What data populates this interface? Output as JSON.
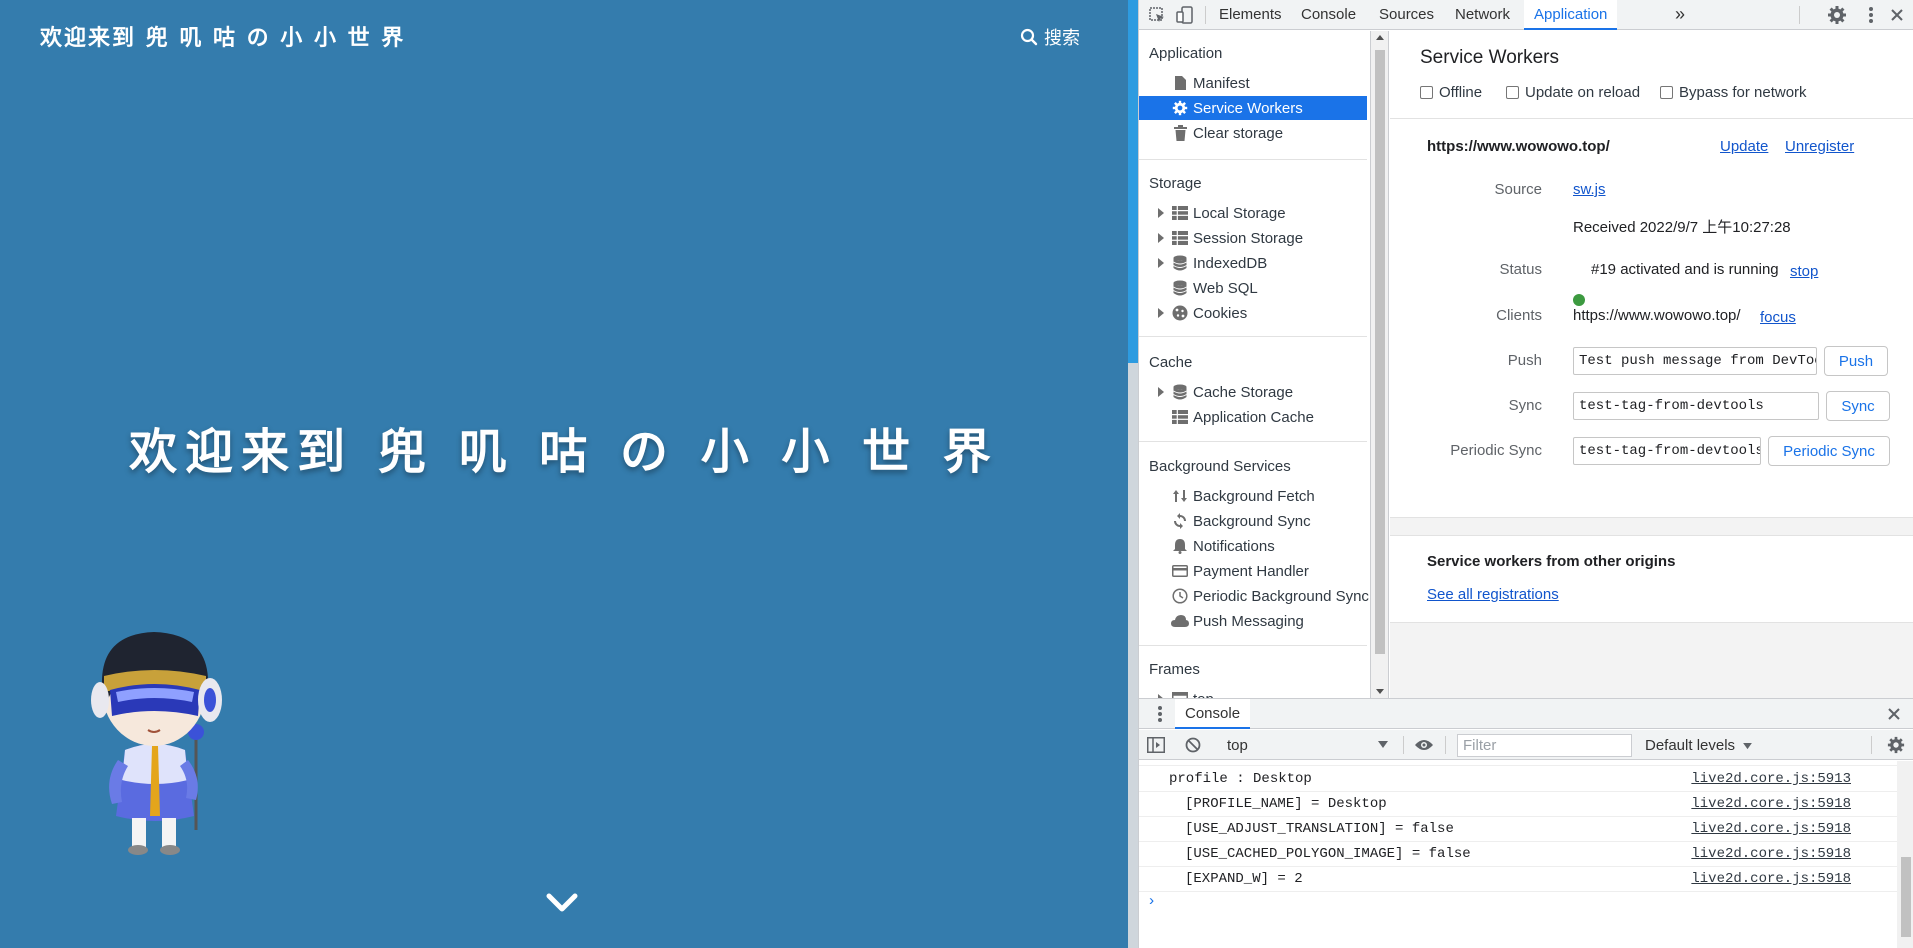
{
  "site": {
    "brand": "欢迎来到 兜 叽 咕 の 小 小 世 界",
    "search_label": "搜索",
    "hero_title": "欢迎来到 兜 叽 咕 の 小 小 世 界",
    "background_color": "#347cad"
  },
  "devtools": {
    "tabs": [
      "Elements",
      "Console",
      "Sources",
      "Network",
      "Application"
    ],
    "active_tab": "Application",
    "more_tabs_glyph": "»",
    "sidebar": {
      "application_header": "Application",
      "application_items": [
        "Manifest",
        "Service Workers",
        "Clear storage"
      ],
      "selected_item": "Service Workers",
      "storage_header": "Storage",
      "storage_items": [
        "Local Storage",
        "Session Storage",
        "IndexedDB",
        "Web SQL",
        "Cookies"
      ],
      "cache_header": "Cache",
      "cache_items": [
        "Cache Storage",
        "Application Cache"
      ],
      "background_header": "Background Services",
      "background_items": [
        "Background Fetch",
        "Background Sync",
        "Notifications",
        "Payment Handler",
        "Periodic Background Sync",
        "Push Messaging"
      ],
      "frames_header": "Frames",
      "frames_items": [
        "top"
      ]
    },
    "service_workers": {
      "title": "Service Workers",
      "checkboxes": [
        "Offline",
        "Update on reload",
        "Bypass for network"
      ],
      "origin": "https://www.wowowo.top/",
      "update_link": "Update",
      "unregister_link": "Unregister",
      "source_label": "Source",
      "source_file": "sw.js",
      "received": "Received 2022/9/7 上午10:27:28",
      "status_label": "Status",
      "status_text": "#19 activated and is running",
      "status_color": "#3c9a40",
      "stop_link": "stop",
      "clients_label": "Clients",
      "clients_value": "https://www.wowowo.top/",
      "focus_link": "focus",
      "push_label": "Push",
      "push_value": "Test push message from DevTools.",
      "push_button": "Push",
      "sync_label": "Sync",
      "sync_value": "test-tag-from-devtools",
      "sync_button": "Sync",
      "periodic_label": "Periodic Sync",
      "periodic_value": "test-tag-from-devtools",
      "periodic_button": "Periodic Sync",
      "other_origins_title": "Service workers from other origins",
      "see_all_link": "See all registrations"
    },
    "console": {
      "tab_label": "Console",
      "context": "top",
      "filter_placeholder": "Filter",
      "levels": "Default levels",
      "lines": [
        {
          "text": "profile : Desktop",
          "indent": 0,
          "source": "live2d.core.js:5913"
        },
        {
          "text": "[PROFILE_NAME] = Desktop",
          "indent": 1,
          "source": "live2d.core.js:5918"
        },
        {
          "text": "[USE_ADJUST_TRANSLATION] = false",
          "indent": 1,
          "source": "live2d.core.js:5918"
        },
        {
          "text": "[USE_CACHED_POLYGON_IMAGE] = false",
          "indent": 1,
          "source": "live2d.core.js:5918"
        },
        {
          "text": "[EXPAND_W] = 2",
          "indent": 1,
          "source": "live2d.core.js:5918"
        }
      ],
      "prompt_glyph": "›"
    },
    "accent_color": "#1a73e8"
  }
}
